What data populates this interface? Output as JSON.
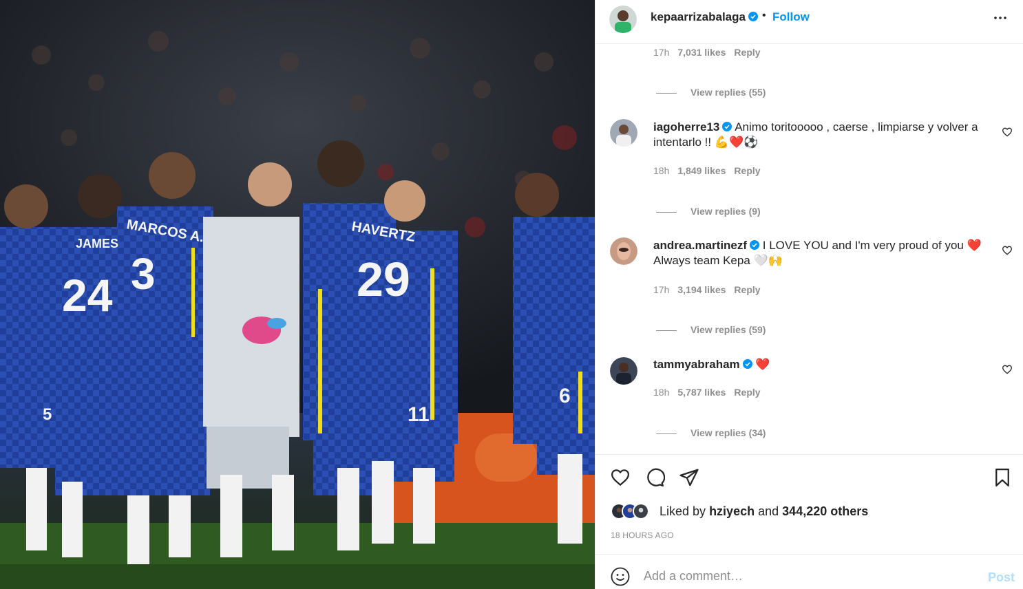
{
  "colors": {
    "accent": "#0095f6",
    "muted": "#8e8e8e",
    "text": "#262626",
    "heart": "#ed4956"
  },
  "photo": {
    "shirt_texts": [
      "MARCOS A.",
      "3",
      "JAMES",
      "24",
      "HAVERTZ",
      "29",
      "11",
      "6",
      "5"
    ]
  },
  "header": {
    "username": "kepaarrizabalaga",
    "separator": "•",
    "follow_label": "Follow",
    "more_icon": "more-horizontal-icon"
  },
  "comments": {
    "first_meta": {
      "time": "17h",
      "likes": "7,031 likes",
      "reply": "Reply"
    },
    "first_replies": "View replies (55)",
    "items": [
      {
        "username": "iagoherre13",
        "text": "Animo toritooooo , caerse , limpiarse y volver a intentarlo !! ",
        "emojis": "💪❤️⚽",
        "time": "18h",
        "likes": "1,849 likes",
        "reply": "Reply",
        "replies": "View replies (9)"
      },
      {
        "username": "andrea.martinezf",
        "text": "I LOVE YOU and I'm very proud of you ",
        "text2": "Always team Kepa ",
        "emojis": "❤️",
        "emojis2": "🤍🙌",
        "time": "17h",
        "likes": "3,194 likes",
        "reply": "Reply",
        "replies": "View replies (59)"
      },
      {
        "username": "tammyabraham",
        "text": "",
        "emojis": "❤️",
        "time": "18h",
        "likes": "5,787 likes",
        "reply": "Reply",
        "replies": "View replies (34)"
      }
    ]
  },
  "actions": {
    "icons": [
      "heart-icon",
      "comment-icon",
      "share-icon",
      "bookmark-icon"
    ],
    "liked_by_prefix": "Liked by",
    "liked_by_user": "hziyech",
    "liked_by_and": "and",
    "liked_by_others": "344,220 others",
    "timestamp": "18 HOURS AGO"
  },
  "add_comment": {
    "placeholder": "Add a comment…",
    "post_label": "Post",
    "emoji_icon": "smiley-icon"
  }
}
